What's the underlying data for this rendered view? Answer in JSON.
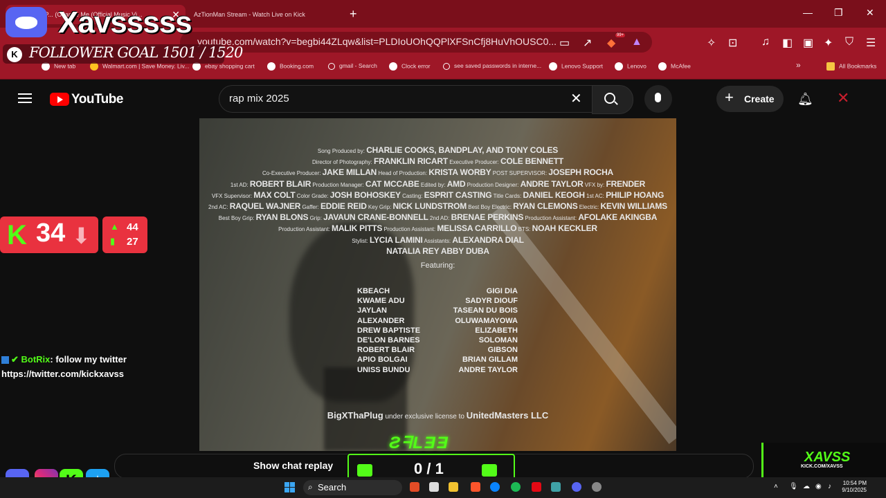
{
  "browser": {
    "tabs": [
      {
        "title": "igXThaP... (Change Me (Official Music Vi...",
        "active": true
      },
      {
        "title": "AzTionMan Stream - Watch Live on Kick",
        "active": false
      }
    ],
    "url": "youtube.com/watch?v=begbi44ZLqw&list=PLDIoUOhQQPlXFSnCfj8HuVhOUSC0...",
    "extension_badge": "99+",
    "bookmarks": [
      "New tab",
      "Walmart.com | Save Money. Liv...",
      "ebay shopping cart",
      "Booking.com",
      "gmail - Search",
      "Clock error",
      "see saved passwords in interne...",
      "Lenovo Support",
      "Lenovo",
      "McAfee"
    ],
    "all_bookmarks": "All Bookmarks"
  },
  "youtube": {
    "logo_text": "YouTube",
    "search_query": "rap mix 2025",
    "create_label": "Create",
    "show_chat_replay": "Show chat replay"
  },
  "video": {
    "credit_lines": [
      [
        [
          "s",
          "Song Produced by: "
        ],
        [
          "b",
          "CHARLIE COOKS, BANDPLAY, AND TONY COLES"
        ]
      ],
      [
        [
          "s",
          "Director of Photography: "
        ],
        [
          "b",
          "FRANKLIN RICART"
        ],
        [
          "s",
          " Executive Producer: "
        ],
        [
          "b",
          "COLE BENNETT"
        ]
      ],
      [
        [
          "s",
          "Co-Executive Producer: "
        ],
        [
          "b",
          "JAKE MILLAN"
        ],
        [
          "s",
          " Head of Production: "
        ],
        [
          "b",
          "KRISTA WORBY"
        ],
        [
          "s",
          " POST SUPERVISOR: "
        ],
        [
          "b",
          "JOSEPH ROCHA"
        ]
      ],
      [
        [
          "s",
          "1st AD: "
        ],
        [
          "b",
          "ROBERT BLAIR"
        ],
        [
          "s",
          " Production Manager: "
        ],
        [
          "b",
          "CAT MCCABE"
        ],
        [
          "s",
          " Edited by: "
        ],
        [
          "b",
          "AMD"
        ],
        [
          "s",
          " Production Designer: "
        ],
        [
          "b",
          "ANDRE TAYLOR"
        ],
        [
          "s",
          " VFX by: "
        ],
        [
          "b",
          "FRENDER"
        ]
      ],
      [
        [
          "s",
          "VFX Supervisor: "
        ],
        [
          "b",
          "MAX COLT"
        ],
        [
          "s",
          " Color Grade: "
        ],
        [
          "b",
          "JOSH BOHOSKEY"
        ],
        [
          "s",
          " Casting: "
        ],
        [
          "b",
          "ESPRIT CASTING"
        ],
        [
          "s",
          " Title Cards: "
        ],
        [
          "b",
          "DANIEL KEOGH"
        ],
        [
          "s",
          " 1st AC: "
        ],
        [
          "b",
          "PHILIP HOANG"
        ]
      ],
      [
        [
          "s",
          "2nd AC: "
        ],
        [
          "b",
          "RAQUEL WAJNER"
        ],
        [
          "s",
          " Gaffer: "
        ],
        [
          "b",
          "EDDIE REID"
        ],
        [
          "s",
          " Key Grip: "
        ],
        [
          "b",
          "NICK LUNDSTROM"
        ],
        [
          "s",
          " Best Boy Electric: "
        ],
        [
          "b",
          "RYAN CLEMONS"
        ],
        [
          "s",
          " Electric: "
        ],
        [
          "b",
          "KEVIN WILLIAMS"
        ]
      ],
      [
        [
          "s",
          "Best Boy Grip: "
        ],
        [
          "b",
          "RYAN BLONS"
        ],
        [
          "s",
          " Grip: "
        ],
        [
          "b",
          "JAVAUN CRANE-BONNELL"
        ],
        [
          "s",
          " 2nd AD: "
        ],
        [
          "b",
          "BRENAE PERKINS"
        ],
        [
          "s",
          " Production Assistant: "
        ],
        [
          "b",
          "AFOLAKE AKINGBA"
        ]
      ],
      [
        [
          "s",
          "Production Assistant: "
        ],
        [
          "b",
          "MALIK PITTS"
        ],
        [
          "s",
          " Production Assistant: "
        ],
        [
          "b",
          "MELISSA CARRILLO"
        ],
        [
          "s",
          " BTS: "
        ],
        [
          "b",
          "NOAH KECKLER"
        ]
      ],
      [
        [
          "s",
          "Stylist: "
        ],
        [
          "b",
          "LYCIA LAMINI"
        ],
        [
          "s",
          " Assistants: "
        ],
        [
          "b",
          "ALEXANDRA DIAL"
        ]
      ],
      [
        [
          "b",
          "NATALIA REY ABBY DUBA"
        ]
      ]
    ],
    "featuring_label": "Featuring:",
    "featuring_left": [
      "KBEACH",
      "KWAME ADU",
      "JAYLAN",
      "ALEXANDER",
      "DREW BAPTISTE",
      "DE'LON BARNES",
      "ROBERT BLAIR",
      "APIO BOLGAI",
      "UNISS BUNDU"
    ],
    "featuring_right": [
      "GIGI DIA",
      "SADYR DIOUF",
      "TASEAN DU BOIS",
      "OLUWAMAYOWA",
      "ELIZABETH",
      "SOLOMAN",
      "GIBSON",
      "BRIAN GILLAM",
      "ANDRE TAYLOR"
    ],
    "license": {
      "artist": "BigXThaPlug",
      "middle": " under exclusive license to ",
      "label": "UnitedMasters LLC"
    }
  },
  "overlay": {
    "streamer_name": "Xavsssss",
    "follower_goal": "FOLLOWER GOAL 1501 / 1520",
    "viewer_count": "34",
    "stat_up": "44",
    "stat_bars": "27",
    "chat_user": "BotRix",
    "chat_message": ": follow my twitter",
    "chat_link": "https://twitter.com/kickxavss",
    "goal_counter": "0 / 1",
    "brand_name": "XAVSS",
    "brand_url": "KICK.COM/XAVSS"
  },
  "taskbar": {
    "search_label": "Search",
    "time": "10:54 PM",
    "date": "9/10/2025"
  },
  "colors": {
    "browser_red": "#9e1727",
    "kick_green": "#53fc18",
    "yt_red": "#ff0000"
  }
}
